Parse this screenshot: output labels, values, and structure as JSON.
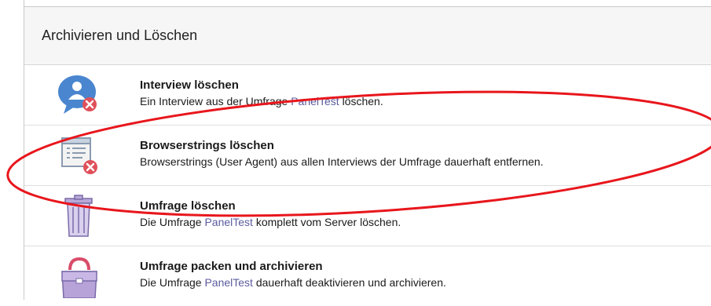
{
  "section": {
    "title": "Archivieren und Löschen"
  },
  "items": [
    {
      "title": "Interview löschen",
      "pre": "Ein Interview aus der Umfrage ",
      "link": "PanelTest",
      "post": " löschen."
    },
    {
      "title": "Browserstrings löschen",
      "pre": "Browserstrings (User Agent) aus allen Interviews der Umfrage dauerhaft entfernen.",
      "link": "",
      "post": ""
    },
    {
      "title": "Umfrage löschen",
      "pre": "Die Umfrage ",
      "link": "PanelTest",
      "post": " komplett vom Server löschen."
    },
    {
      "title": "Umfrage packen und archivieren",
      "pre": "Die Umfrage ",
      "link": "PanelTest",
      "post": " dauerhaft deaktivieren und archivieren."
    }
  ],
  "colors": {
    "annotation_ellipse": "#e8161c",
    "link": "#5b5b9f",
    "delete_badge": "#e0505a"
  }
}
